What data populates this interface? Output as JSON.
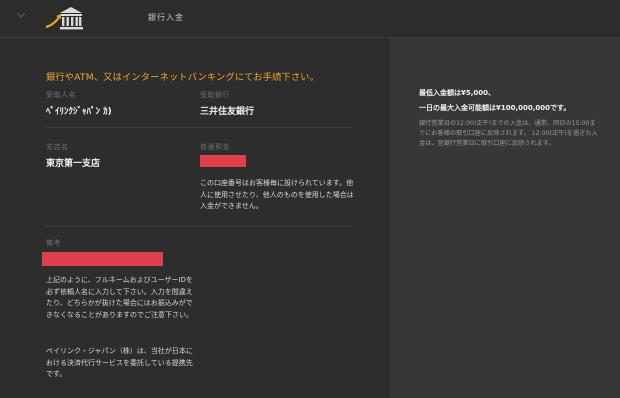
{
  "header": {
    "title": "銀行入金"
  },
  "instruction": "銀行やATM、又はインターネットバンキングにてお手続下さい。",
  "fields": {
    "recipient_label": "受取人名",
    "recipient_value": "ﾍﾟｲﾘﾝｸｼﾞｬﾊﾟﾝ ｶ)",
    "bank_label": "受取銀行",
    "bank_value": "三井住友銀行",
    "branch_label": "支店名",
    "branch_value": "東京第一支店",
    "account_label": "普通預金",
    "account_note": "この口座番号はお客様毎に設けられています。他人に使用させたり、他人のものを使用した場合は入金ができません。",
    "reference_label": "備考",
    "reference_note": "上記のように、フルネームおよびユーザーIDを必ず依頼人名に入力して下さい。入力を間違えたり、どちらかが抜けた場合にはお振込みができなくなることがありますのでご注意下さい。",
    "company_note": "ペイリンク・ジャパン（株）は、当社が日本における決済代行サービスを委託している提携先です。"
  },
  "side": {
    "min_deposit": "最低入金額は¥5,000、",
    "max_deposit": "一日の最大入金可能額は¥100,000,000です。",
    "processing_note": "銀行営業日の12:00(正午)までの入金は、通常、同日の15:00までにお客様の取引口座に反映されます。 12:00(正午)を過ぎた入金は、翌銀行営業日に取引口座に反映されます。"
  },
  "colors": {
    "accent": "#f3a72a",
    "redacted": "#e0404d",
    "icon_gold": "#e8a028"
  },
  "icons": {
    "chevron": "chevron-down-icon",
    "bank": "bank-icon",
    "arrow": "arrow-up-right-icon"
  }
}
